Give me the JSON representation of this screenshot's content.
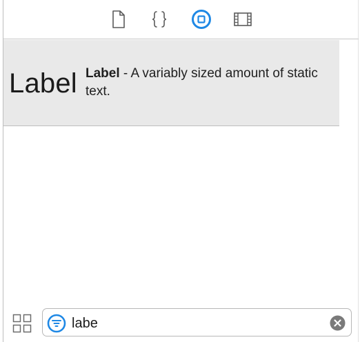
{
  "toolbar": {
    "buttons": [
      {
        "icon": "file-icon",
        "selected": false
      },
      {
        "icon": "braces-icon",
        "selected": false
      },
      {
        "icon": "object-library-icon",
        "selected": true
      },
      {
        "icon": "media-library-icon",
        "selected": false
      }
    ],
    "accent_color": "#1e88e5"
  },
  "library": {
    "items": [
      {
        "thumbnail_text": "Label",
        "name": "Label",
        "separator": " - ",
        "description": "A variably sized amount of static text."
      }
    ]
  },
  "bottom_bar": {
    "view_toggle_icon": "grid-view-icon",
    "search": {
      "value": "labe",
      "filter_icon": "filter-icon",
      "clear_icon": "clear-icon"
    }
  }
}
